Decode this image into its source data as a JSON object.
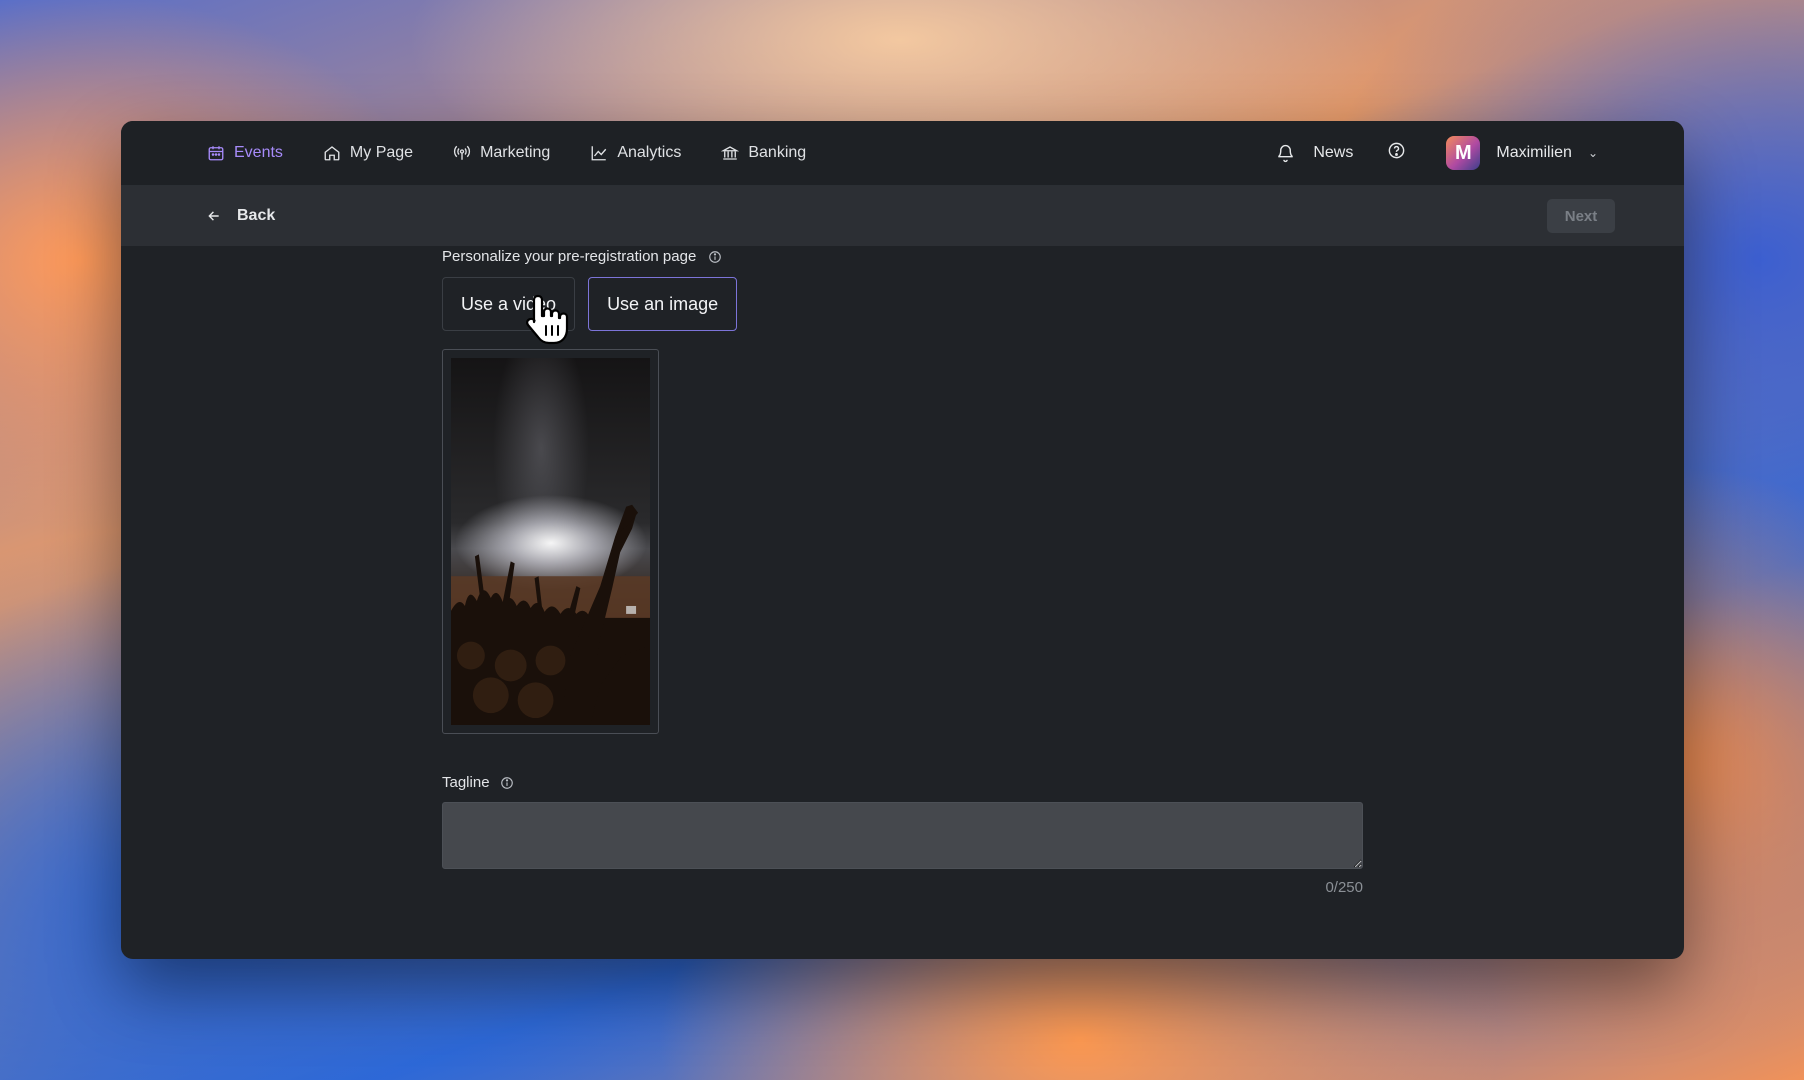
{
  "nav": {
    "items": [
      {
        "label": "Events",
        "icon": "calendar-icon",
        "active": true
      },
      {
        "label": "My Page",
        "icon": "home-icon"
      },
      {
        "label": "Marketing",
        "icon": "broadcast-icon"
      },
      {
        "label": "Analytics",
        "icon": "chart-line-icon"
      },
      {
        "label": "Banking",
        "icon": "bank-icon"
      }
    ],
    "news_label": "News",
    "user_name": "Maximilien",
    "avatar_letter": "M"
  },
  "subbar": {
    "back_label": "Back",
    "next_label": "Next"
  },
  "form": {
    "personalize_label": "Personalize your pre-registration page",
    "video_option": "Use a video",
    "image_option": "Use an image",
    "selected_option": "Use an image",
    "tagline_label": "Tagline",
    "tagline_value": "",
    "counter": "0/250"
  },
  "colors": {
    "accent": "#a78bfa",
    "selected_border": "#7c74d8",
    "window_bg": "#1f2226"
  }
}
